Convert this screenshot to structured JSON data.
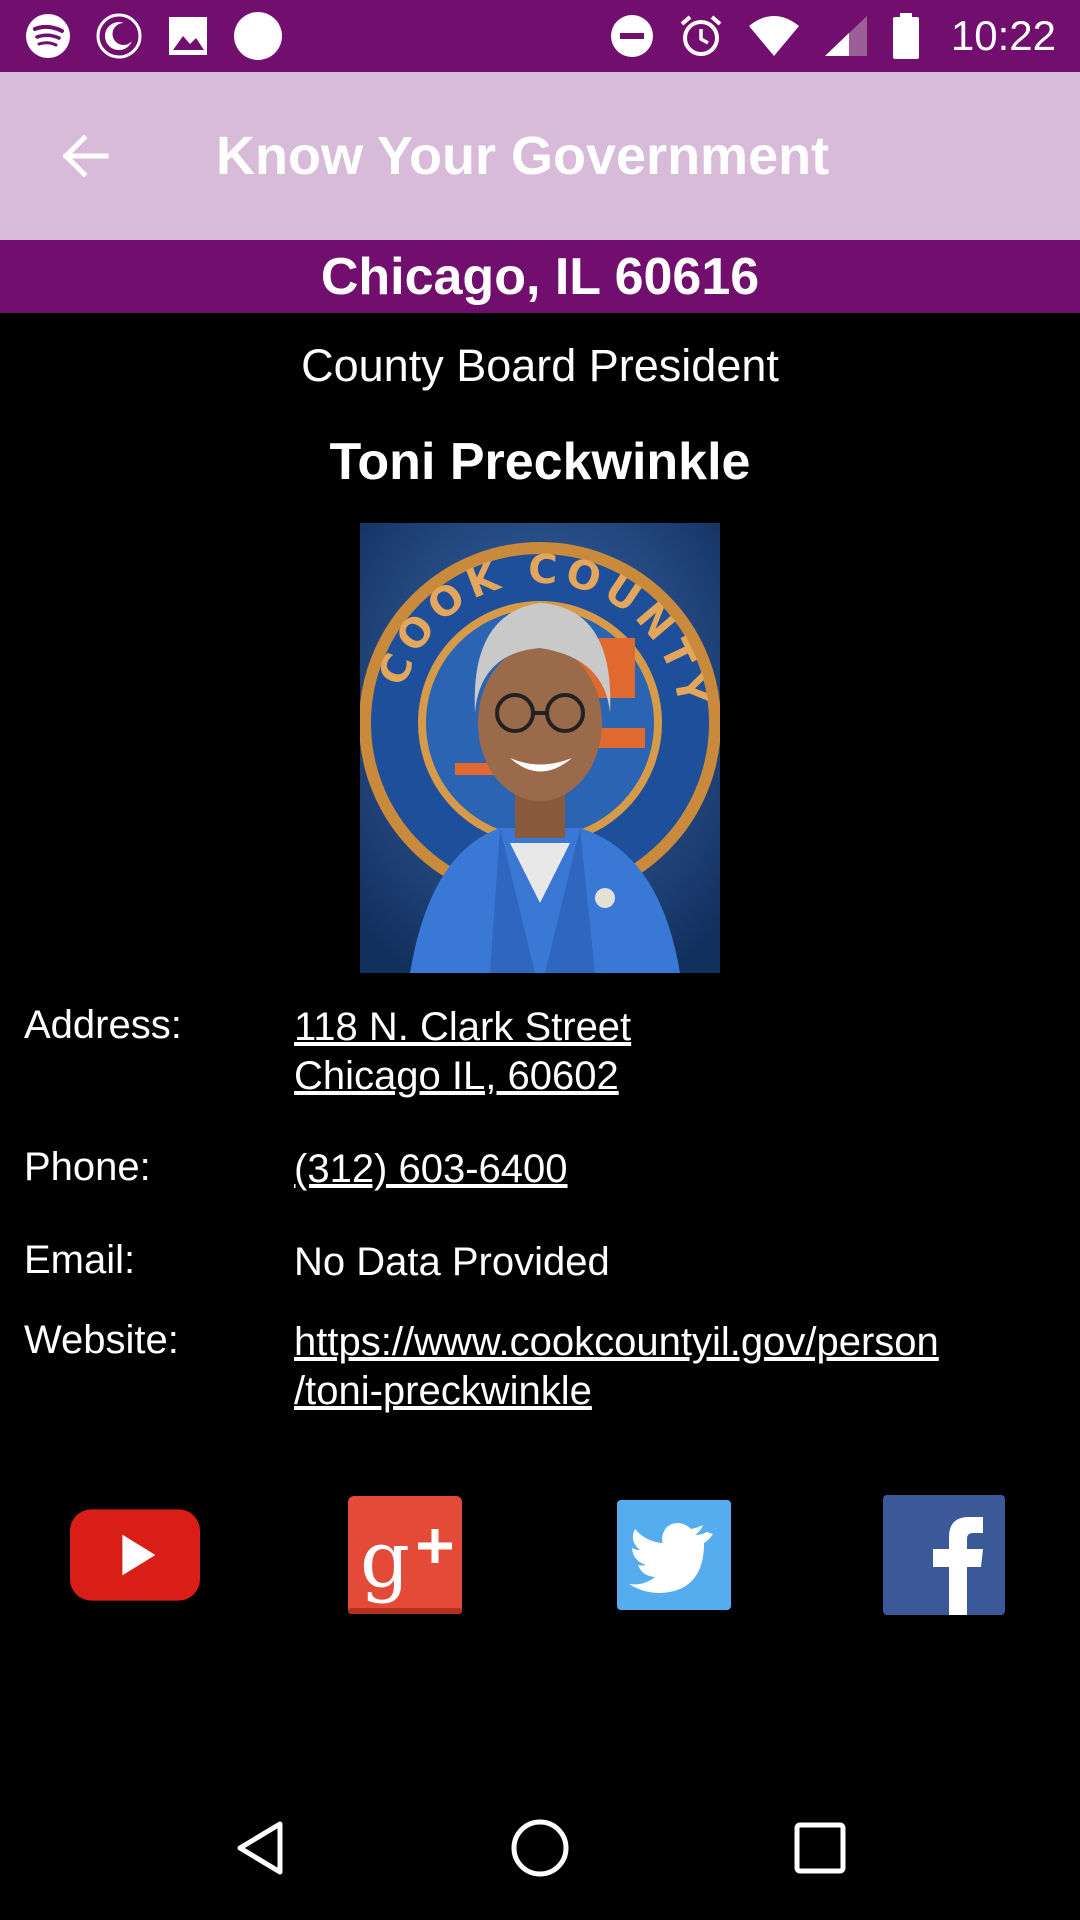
{
  "status_bar": {
    "time": "10:22",
    "icons_left": [
      "spotify-icon",
      "moon-icon",
      "image-icon",
      "circle-icon"
    ],
    "icons_right": [
      "do-not-disturb-icon",
      "alarm-icon",
      "wifi-icon",
      "signal-icon",
      "battery-icon"
    ]
  },
  "app_bar": {
    "title": "Know Your Government",
    "back_icon": "arrow-left-icon"
  },
  "location": "Chicago, IL 60616",
  "official": {
    "office": "County Board President",
    "name": "Toni Preckwinkle",
    "photo_seal_text": "SEAL OF COOK COUNTY"
  },
  "details": {
    "address_label": "Address:",
    "address_line1": "118 N. Clark Street",
    "address_line2": "Chicago IL, 60602",
    "phone_label": "Phone:",
    "phone": "(312) 603-6400",
    "email_label": "Email:",
    "email": "No Data Provided",
    "website_label": "Website:",
    "website_line1": "https://www.cookcountyil.gov/person",
    "website_line2": "/toni-preckwinkle"
  },
  "social": [
    {
      "name": "youtube-icon",
      "color": "#d91e18"
    },
    {
      "name": "google-plus-icon",
      "color": "#e34a37"
    },
    {
      "name": "twitter-icon",
      "color": "#55acee"
    },
    {
      "name": "facebook-icon",
      "color": "#3b5998"
    }
  ],
  "nav_bar": [
    "back-triangle-icon",
    "home-circle-icon",
    "recents-square-icon"
  ]
}
